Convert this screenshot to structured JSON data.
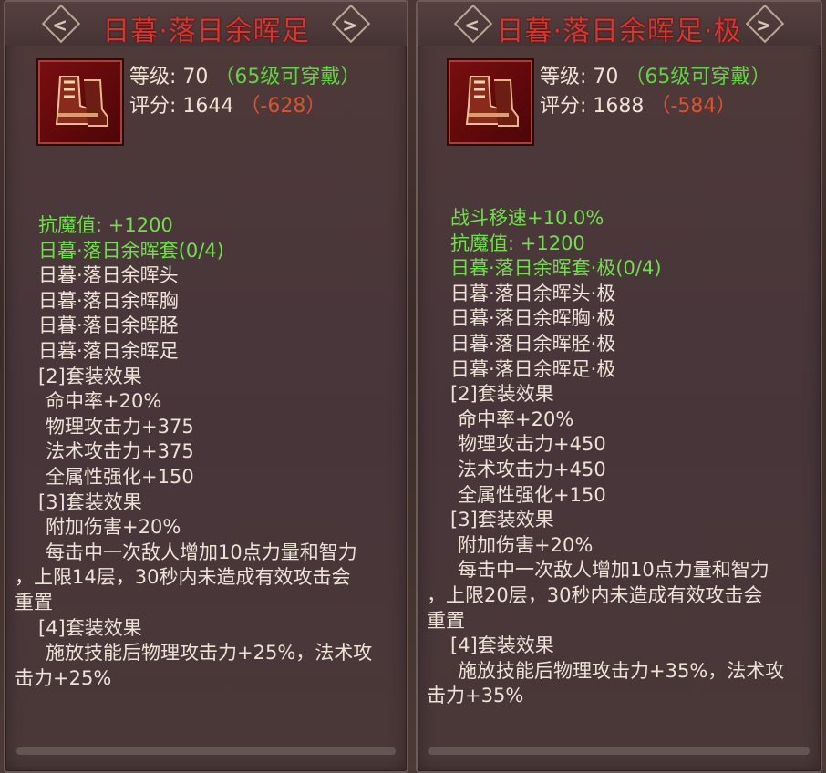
{
  "left": {
    "title": "日暮·落日余晖足",
    "level_label": "等级:",
    "level_value": "70",
    "level_req": "（65级可穿戴）",
    "score_label": "评分:",
    "score_value": "1644",
    "score_diff": "（-628）",
    "lines": [
      {
        "text": "抗魔值: +1200",
        "cls": "green"
      },
      {
        "text": "日暮·落日余晖套(0/4)",
        "cls": "green"
      },
      {
        "text": "日暮·落日余晖头",
        "cls": ""
      },
      {
        "text": "日暮·落日余晖胸",
        "cls": ""
      },
      {
        "text": "日暮·落日余晖胫",
        "cls": ""
      },
      {
        "text": "日暮·落日余晖足",
        "cls": ""
      },
      {
        "text": "[2]套装效果",
        "cls": ""
      },
      {
        "text": "命中率+20%",
        "cls": "ind"
      },
      {
        "text": "物理攻击力+375",
        "cls": "ind"
      },
      {
        "text": "法术攻击力+375",
        "cls": "ind"
      },
      {
        "text": "全属性强化+150",
        "cls": "ind"
      },
      {
        "text": "[3]套装效果",
        "cls": ""
      },
      {
        "text": "附加伤害+20%",
        "cls": "ind"
      },
      {
        "text": "每击中一次敌人增加10点力量和智力",
        "cls": "ind"
      },
      {
        "text": "，上限14层，30秒内未造成有效攻击会",
        "cls": "wrapline"
      },
      {
        "text": "重置",
        "cls": "wrapline"
      },
      {
        "text": "[4]套装效果",
        "cls": ""
      },
      {
        "text": "施放技能后物理攻击力+25%，法术攻",
        "cls": "ind"
      },
      {
        "text": "击力+25%",
        "cls": "wrapline"
      }
    ]
  },
  "right": {
    "title": "日暮·落日余晖足·极",
    "level_label": "等级:",
    "level_value": "70",
    "level_req": "（65级可穿戴）",
    "score_label": "评分:",
    "score_value": "1688",
    "score_diff": "（-584）",
    "lines": [
      {
        "text": "战斗移速+10.0%",
        "cls": "green"
      },
      {
        "text": "抗魔值: +1200",
        "cls": "green"
      },
      {
        "text": "日暮·落日余晖套·极(0/4)",
        "cls": "green"
      },
      {
        "text": "日暮·落日余晖头·极",
        "cls": ""
      },
      {
        "text": "日暮·落日余晖胸·极",
        "cls": ""
      },
      {
        "text": "日暮·落日余晖胫·极",
        "cls": ""
      },
      {
        "text": "日暮·落日余晖足·极",
        "cls": ""
      },
      {
        "text": "[2]套装效果",
        "cls": ""
      },
      {
        "text": "命中率+20%",
        "cls": "ind"
      },
      {
        "text": "物理攻击力+450",
        "cls": "ind"
      },
      {
        "text": "法术攻击力+450",
        "cls": "ind"
      },
      {
        "text": "全属性强化+150",
        "cls": "ind"
      },
      {
        "text": "[3]套装效果",
        "cls": ""
      },
      {
        "text": "附加伤害+20%",
        "cls": "ind"
      },
      {
        "text": "每击中一次敌人增加10点力量和智力",
        "cls": "ind"
      },
      {
        "text": "，上限20层，30秒内未造成有效攻击会",
        "cls": "wrapline"
      },
      {
        "text": "重置",
        "cls": "wrapline"
      },
      {
        "text": "[4]套装效果",
        "cls": ""
      },
      {
        "text": "施放技能后物理攻击力+35%，法术攻",
        "cls": "ind"
      },
      {
        "text": "击力+35%",
        "cls": "wrapline"
      }
    ]
  }
}
